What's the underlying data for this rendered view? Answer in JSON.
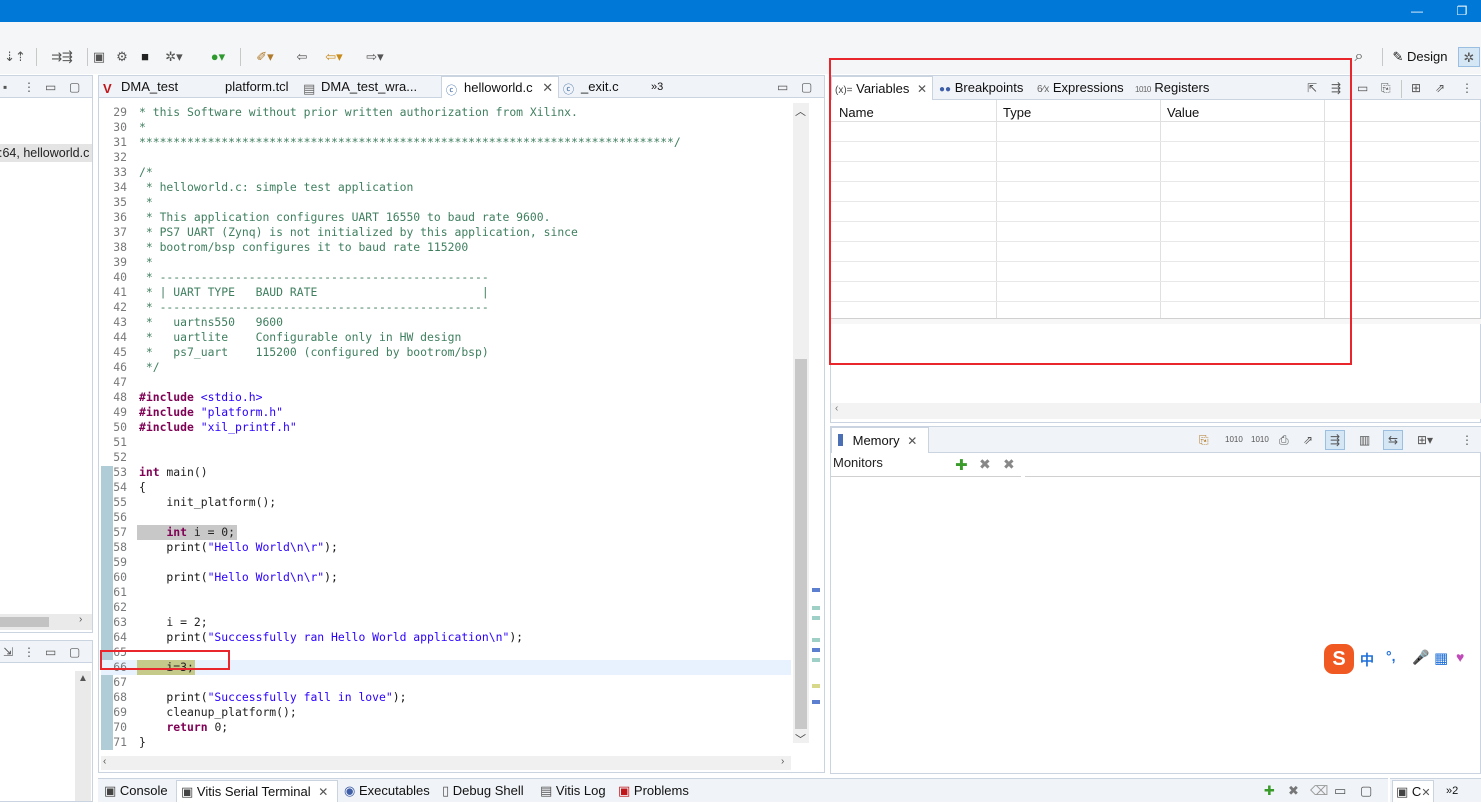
{
  "toolbar": {
    "perspective_design": "Design"
  },
  "left_panel": {
    "debug_entry": ":64, helloworld.c"
  },
  "editor": {
    "tabs": [
      {
        "label": "DMA_test"
      },
      {
        "label": "platform.tcl"
      },
      {
        "label": "DMA_test_wra..."
      },
      {
        "label": "helloworld.c"
      },
      {
        "label": "_exit.c"
      },
      {
        "label": "»3"
      }
    ],
    "lines": [
      {
        "n": "29",
        "t": "* this Software without prior written authorization from Xilinx."
      },
      {
        "n": "30",
        "t": "*"
      },
      {
        "n": "31",
        "t": "******************************************************************************/"
      },
      {
        "n": "32",
        "t": ""
      },
      {
        "n": "33",
        "t": "/*"
      },
      {
        "n": "34",
        "t": " * helloworld.c: simple test application"
      },
      {
        "n": "35",
        "t": " *"
      },
      {
        "n": "36",
        "t": " * This application configures UART 16550 to baud rate 9600."
      },
      {
        "n": "37",
        "t": " * PS7 UART (Zynq) is not initialized by this application, since"
      },
      {
        "n": "38",
        "t": " * bootrom/bsp configures it to baud rate 115200"
      },
      {
        "n": "39",
        "t": " *"
      },
      {
        "n": "40",
        "t": " * ------------------------------------------------"
      },
      {
        "n": "41",
        "t": " * | UART TYPE   BAUD RATE                        |"
      },
      {
        "n": "42",
        "t": " * ------------------------------------------------"
      },
      {
        "n": "43",
        "t": " *   uartns550   9600"
      },
      {
        "n": "44",
        "t": " *   uartlite    Configurable only in HW design"
      },
      {
        "n": "45",
        "t": " *   ps7_uart    115200 (configured by bootrom/bsp)"
      },
      {
        "n": "46",
        "t": " */"
      },
      {
        "n": "47",
        "t": ""
      },
      {
        "n": "48",
        "t": "#include <stdio.h>"
      },
      {
        "n": "49",
        "t": "#include \"platform.h\""
      },
      {
        "n": "50",
        "t": "#include \"xil_printf.h\""
      },
      {
        "n": "51",
        "t": ""
      },
      {
        "n": "52",
        "t": ""
      },
      {
        "n": "53",
        "t": "int main()"
      },
      {
        "n": "54",
        "t": "{"
      },
      {
        "n": "55",
        "t": "    init_platform();"
      },
      {
        "n": "56",
        "t": ""
      },
      {
        "n": "57",
        "t": "    int i = 0;"
      },
      {
        "n": "58",
        "t": "    print(\"Hello World\\n\\r\");"
      },
      {
        "n": "59",
        "t": ""
      },
      {
        "n": "60",
        "t": "    print(\"Hello World\\n\\r\");"
      },
      {
        "n": "61",
        "t": ""
      },
      {
        "n": "62",
        "t": ""
      },
      {
        "n": "63",
        "t": "    i = 2;"
      },
      {
        "n": "64",
        "t": "    print(\"Successfully ran Hello World application\\n\");"
      },
      {
        "n": "65",
        "t": ""
      },
      {
        "n": "66",
        "t": "    i=3;"
      },
      {
        "n": "67",
        "t": ""
      },
      {
        "n": "68",
        "t": "    print(\"Successfully fall in love\");"
      },
      {
        "n": "69",
        "t": "    cleanup_platform();"
      },
      {
        "n": "70",
        "t": "    return 0;"
      },
      {
        "n": "71",
        "t": "}"
      }
    ]
  },
  "variables": {
    "tabs": [
      {
        "label": "Variables"
      },
      {
        "label": "Breakpoints"
      },
      {
        "label": "Expressions"
      },
      {
        "label": "Registers"
      }
    ],
    "columns": [
      "Name",
      "Type",
      "Value"
    ]
  },
  "memory": {
    "tab_label": "Memory",
    "monitors_label": "Monitors"
  },
  "bottom": {
    "tabs": [
      {
        "label": "Console"
      },
      {
        "label": "Vitis Serial Terminal"
      },
      {
        "label": "Executables"
      },
      {
        "label": "Debug Shell"
      },
      {
        "label": "Vitis Log"
      },
      {
        "label": "Problems"
      }
    ],
    "right_tab": "C",
    "overflow": "»2"
  },
  "ime": {
    "logo": "S",
    "lang": "中"
  },
  "colors": {
    "titlebar": "#0078d7",
    "highlight_box": "#e8262b",
    "comment": "#3f7f5f",
    "keyword": "#7f0055",
    "string": "#2a00ff"
  }
}
